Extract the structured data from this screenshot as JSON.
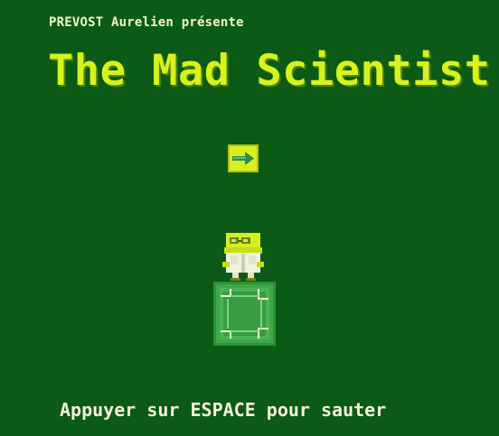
{
  "intro": {
    "presenter": "PREVOST Aurelien présente",
    "title": "The Mad Scientist",
    "instruction": "Appuyer sur ESPACE pour sauter"
  },
  "icons": {
    "goal": "right-arrow-icon",
    "player": "mad-scientist-icon",
    "platform": "stone-block-icon"
  },
  "colors": {
    "background": "#0b5a16",
    "title": "#d7f21c",
    "text": "#f5f2d8",
    "arrow_block": "#d9ef22",
    "platform": "#3ea84b"
  }
}
